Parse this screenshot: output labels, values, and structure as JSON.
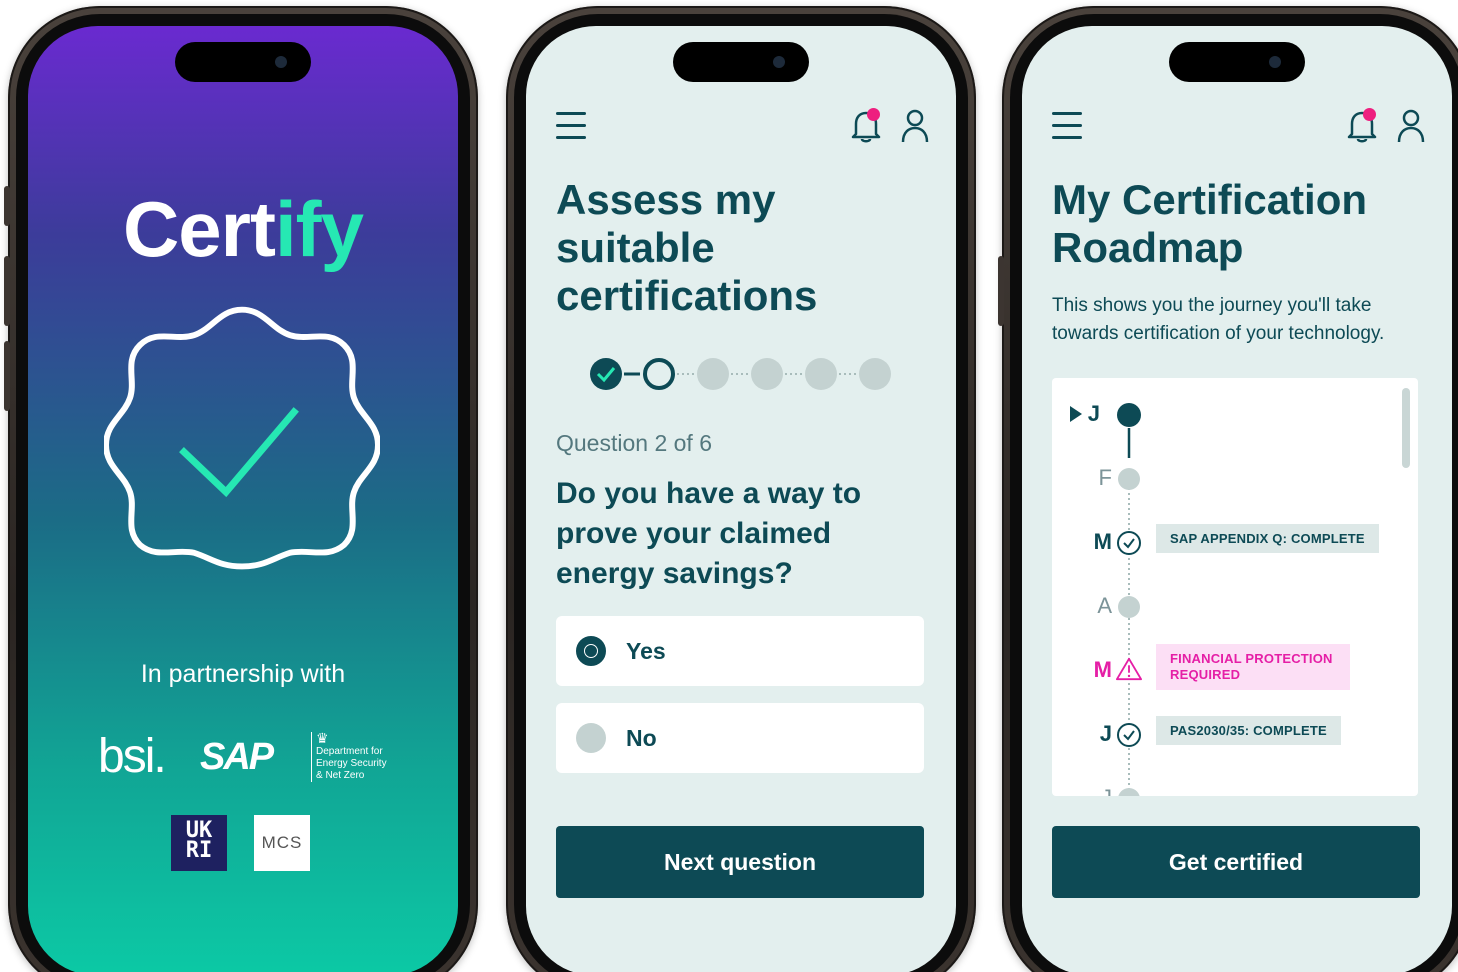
{
  "phone1": {
    "logo_part1": "Cert",
    "logo_part2": "ify",
    "partnership_text": "In partnership with",
    "partners": {
      "bsi": "bsi.",
      "sap": "SAP",
      "desnz": [
        "Department for",
        "Energy Security",
        "& Net Zero"
      ],
      "ukri": [
        "UK",
        "RI"
      ],
      "mcs": "MCS"
    }
  },
  "phone2": {
    "title_lines": [
      "Assess my",
      "suitable",
      "certifications"
    ],
    "question_counter": "Question 2 of 6",
    "question": "Do you have a way to prove your claimed energy savings?",
    "options": [
      {
        "label": "Yes",
        "selected": true
      },
      {
        "label": "No",
        "selected": false
      }
    ],
    "steps": {
      "total": 6,
      "completed": 1,
      "current": 2
    },
    "button_label": "Next question"
  },
  "phone3": {
    "title_lines": [
      "My Certification",
      "Roadmap"
    ],
    "intro": "This shows you the journey you'll take towards certification of your technology.",
    "timeline": [
      {
        "month": "J",
        "state": "current",
        "tag": ""
      },
      {
        "month": "F",
        "state": "future",
        "tag": ""
      },
      {
        "month": "M",
        "state": "complete",
        "tag": "SAP APPENDIX Q: COMPLETE"
      },
      {
        "month": "A",
        "state": "future",
        "tag": ""
      },
      {
        "month": "M",
        "state": "warning",
        "tag": "FINANCIAL PROTECTION REQUIRED"
      },
      {
        "month": "J",
        "state": "complete",
        "tag": "PAS2030/35: COMPLETE"
      },
      {
        "month": "J",
        "state": "future",
        "tag": ""
      }
    ],
    "button_label": "Get certified"
  },
  "colors": {
    "teal_dark": "#0d4a55",
    "mint": "#26e8b3",
    "pink_alert": "#e51fa6",
    "notification": "#ee1f7f",
    "screen_bg": "#e3efee"
  },
  "icons": [
    "menu-icon",
    "bell-icon",
    "user-icon",
    "check-circle-icon",
    "warning-icon",
    "badge-check-icon"
  ]
}
